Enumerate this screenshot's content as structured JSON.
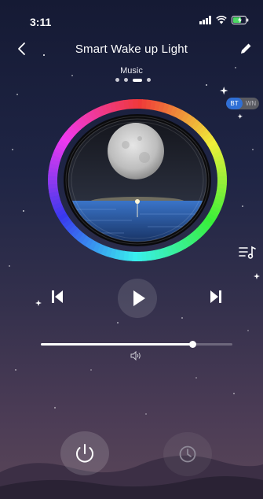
{
  "status_bar": {
    "time": "3:11"
  },
  "nav": {
    "title": "Smart Wake up Light"
  },
  "mode": {
    "label": "Music",
    "page_count": 4,
    "active_page": 3
  },
  "source_toggle": {
    "on_label": "BT",
    "off_label": "WN",
    "selected": "BT"
  },
  "player": {
    "volume_level": 0.79
  },
  "icons": {
    "back": "chevron-left-icon",
    "edit": "pencil-icon",
    "playlist": "playlist-music-icon",
    "prev": "skip-previous-icon",
    "play": "play-icon",
    "next": "skip-next-icon",
    "volume": "speaker-icon",
    "power": "power-icon",
    "timer": "clock-icon"
  },
  "colors": {
    "accent": "#2f6fd6",
    "toggle_bg": "#5a5b62",
    "bg_top": "#151a34",
    "bg_bottom": "#5a4658"
  }
}
